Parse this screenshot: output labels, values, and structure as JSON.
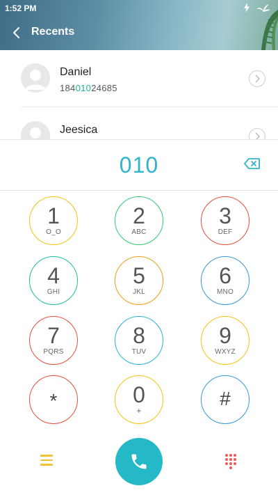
{
  "status_bar": {
    "time": "1:52 PM",
    "icons": [
      "charging-bolt-icon",
      "leaf-logo-icon"
    ]
  },
  "header": {
    "title": "Recents",
    "back_icon": "chevron-left-icon"
  },
  "contacts": [
    {
      "name": "Daniel",
      "number_prefix": "184",
      "number_match": "010",
      "number_suffix": "24685"
    },
    {
      "name": "Jeesica"
    }
  ],
  "dial": {
    "number": "010",
    "backspace_icon": "backspace-icon"
  },
  "keypad": {
    "keys": [
      {
        "digit": "1",
        "letters": "O_O",
        "color": "#f1c40f"
      },
      {
        "digit": "2",
        "letters": "ABC",
        "color": "#2ecc71"
      },
      {
        "digit": "3",
        "letters": "DEF",
        "color": "#e74c3c"
      },
      {
        "digit": "4",
        "letters": "GHI",
        "color": "#1abc9c"
      },
      {
        "digit": "5",
        "letters": "JKL",
        "color": "#f39c12"
      },
      {
        "digit": "6",
        "letters": "MNO",
        "color": "#3498db"
      },
      {
        "digit": "7",
        "letters": "PQRS",
        "color": "#e74c3c"
      },
      {
        "digit": "8",
        "letters": "TUV",
        "color": "#2ab0d6"
      },
      {
        "digit": "9",
        "letters": "WXYZ",
        "color": "#f1c40f"
      },
      {
        "digit": "*",
        "letters": "",
        "color": "#e74c3c"
      },
      {
        "digit": "0",
        "letters": "+",
        "color": "#f1c40f"
      },
      {
        "digit": "#",
        "letters": "",
        "color": "#3498db"
      }
    ]
  },
  "bottom_bar": {
    "menu_icon": "hamburger-menu-icon",
    "call_icon": "phone-icon",
    "dialpad_icon": "dialpad-grid-icon",
    "colors": {
      "menu": "#f0c234",
      "call": "#25b9c7",
      "dialpad": "#ec5b5b"
    }
  }
}
